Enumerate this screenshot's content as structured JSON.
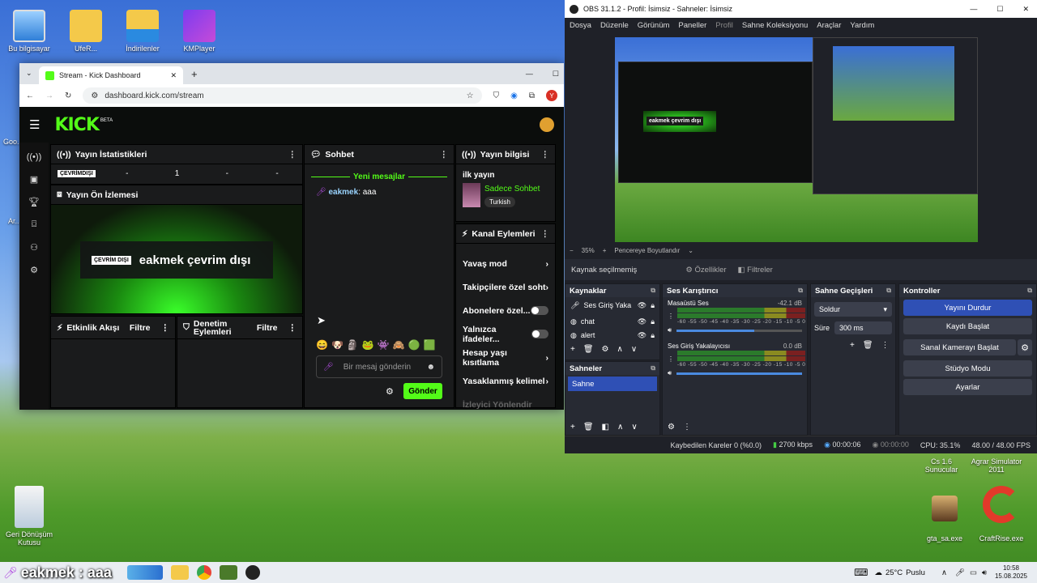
{
  "desktop": {
    "icons_top": [
      "Bu bilgisayar",
      "UfeR...",
      "İndirilenler",
      "KMPlayer"
    ],
    "left_partial": [
      "Goo...",
      "Ar..."
    ],
    "recycle": "Geri Dönüşüm Kutusu",
    "right_icons": [
      "Cs 1.6 Sunucular",
      "Agrar Simulator 2011",
      "gta_sa.exe",
      "CraftRise.exe"
    ]
  },
  "chrome": {
    "tab_title": "Stream - Kick Dashboard",
    "new_tab": "+",
    "url": "dashboard.kick.com/stream"
  },
  "kick": {
    "logo": "KICK",
    "logo_badge": "BETA",
    "stats": {
      "title": "Yayın İstatistikleri",
      "offline_label": "ÇEVRİMDIŞI",
      "values": [
        "-",
        "1",
        "-",
        "-"
      ]
    },
    "preview": {
      "title": "Yayın Ön İzlemesi",
      "badge": "ÇEVRİM DIŞI",
      "text": "eakmek çevrim dışı"
    },
    "activity": {
      "title": "Etkinlik Akışı",
      "filter": "Filtre"
    },
    "moderation": {
      "title": "Denetim Eylemleri",
      "filter": "Filtre"
    },
    "chat": {
      "title": "Sohbet",
      "new_messages": "Yeni mesajlar",
      "messages": [
        {
          "user": "eakmek",
          "text": ": aaa"
        }
      ],
      "emotes": [
        "😄",
        "🐶",
        "🗿",
        "🐸",
        "👾",
        "🙈",
        "🟢",
        "🟩"
      ],
      "placeholder": "Bir mesaj gönderin",
      "send": "Gönder"
    },
    "stream_info": {
      "title": "Yayın bilgisi",
      "stream_title": "ilk yayın",
      "category": "Sadece Sohbet",
      "tag": "Turkish"
    },
    "channel_actions": {
      "title": "Kanal Eylemleri",
      "items": [
        "Yavaş mod",
        "Takipçilere özel soht",
        "Abonelere özel...",
        "Yalnızca ifadeler...",
        "Hesap yaşı kısıtlama",
        "Yasaklanmış kelimel",
        "İzleyici Yönlendir"
      ]
    }
  },
  "obs": {
    "title": "OBS 31.1.2 - Profil: İsimsiz - Sahneler: İsimsiz",
    "menu": [
      "Dosya",
      "Düzenle",
      "Görünüm",
      "Paneller",
      "Profil",
      "Sahne Koleksiyonu",
      "Araçlar",
      "Yardım"
    ],
    "preview_inner": "eakmek çevrim dışı",
    "zoom": "35%",
    "fit": "Pencereye Boyutlandır",
    "no_source": "Kaynak seçilmemiş",
    "properties": "Özellikler",
    "filters": "Filtreler",
    "sources": {
      "title": "Kaynaklar",
      "items": [
        "Ses Giriş Yaka",
        "chat",
        "alert"
      ]
    },
    "scenes": {
      "title": "Sahneler",
      "items": [
        "Sahne"
      ]
    },
    "mixer": {
      "title": "Ses Karıştırıcı",
      "tracks": [
        {
          "name": "Masaüstü Ses",
          "db": "-42.1 dB",
          "volume": 0.62
        },
        {
          "name": "Ses Giriş Yakalayıcısı",
          "db": "0.0 dB",
          "volume": 1.0
        }
      ],
      "scale": "-60 -55 -50 -45 -40 -35 -30 -25 -20 -15 -10 -5 0"
    },
    "transitions": {
      "title": "Sahne Geçişleri",
      "type": "Soldur",
      "duration_label": "Süre",
      "duration": "300 ms"
    },
    "controls": {
      "title": "Kontroller",
      "buttons": [
        "Yayını Durdur",
        "Kaydı Başlat",
        "Sanal Kamerayı Başlat",
        "Stüdyo Modu",
        "Ayarlar"
      ]
    },
    "status": {
      "dropped": "Kaybedilen Kareler 0 (%0.0)",
      "bitrate": "2700 kbps",
      "stream_time": "00:00:06",
      "rec_time": "00:00:00",
      "cpu": "CPU: 35.1%",
      "fps": "48.00 / 48.00 FPS"
    }
  },
  "taskbar": {
    "overlay_text": "eakmek : aaa",
    "weather": "25°C",
    "weather_desc": "Puslu",
    "time": "10:58",
    "date": "15.08.2025"
  },
  "colors": {
    "kick_green": "#53fc18",
    "obs_blue": "#2f50b5"
  }
}
